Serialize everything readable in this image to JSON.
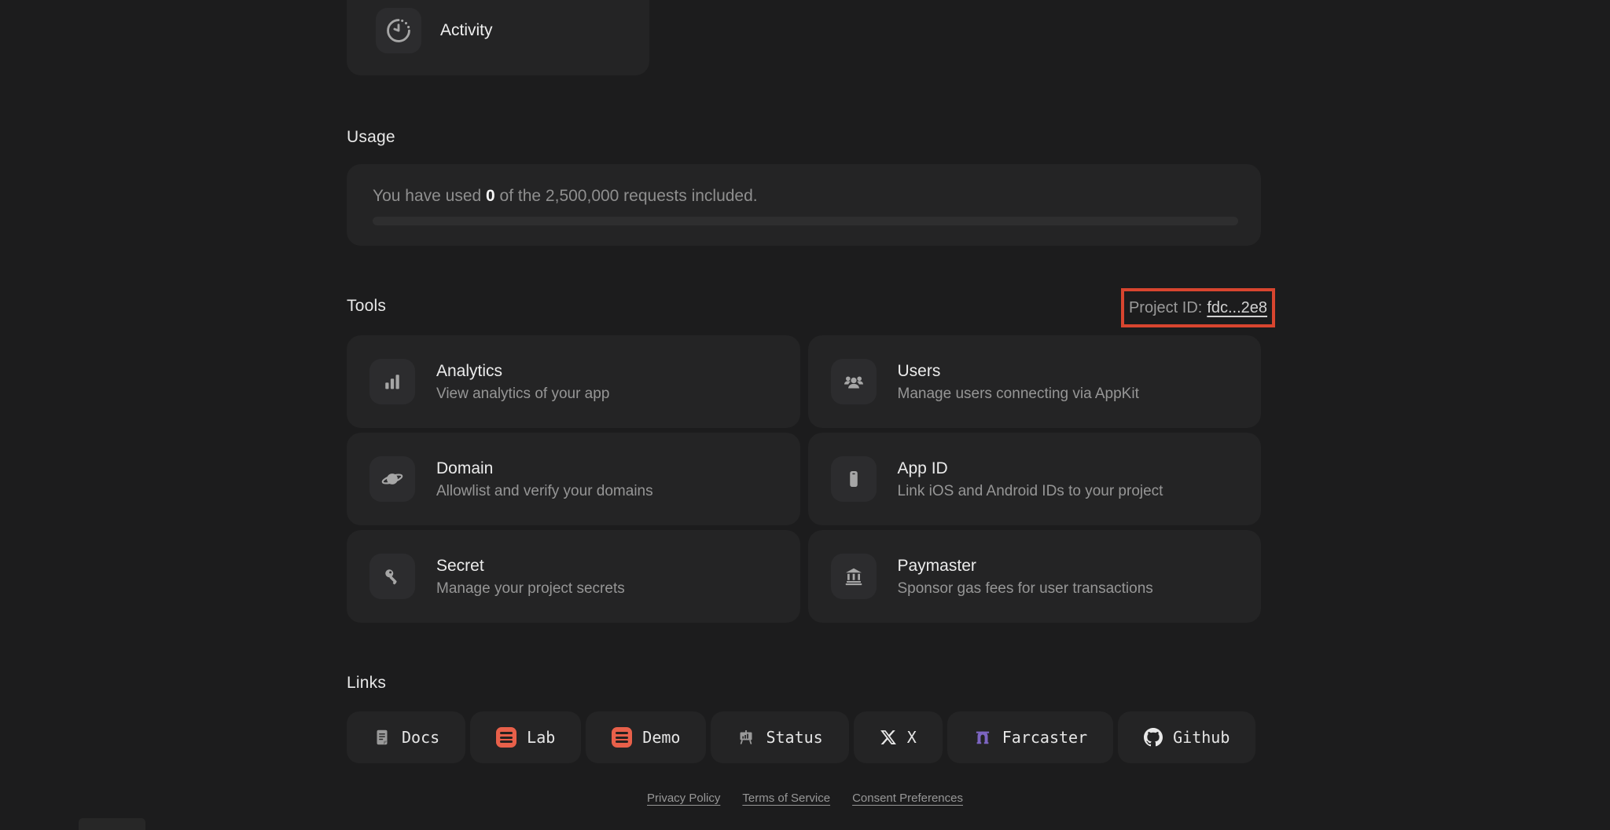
{
  "activity": {
    "label": "Activity"
  },
  "usage": {
    "heading": "Usage",
    "message_prefix": "You have used ",
    "used_count": "0",
    "message_suffix": " of the 2,500,000 requests included.",
    "progress_percent": 0
  },
  "tools": {
    "heading": "Tools",
    "project_id": {
      "label": "Project ID:",
      "value": "fdc...2e8",
      "highlight_color": "#d8452f"
    },
    "cards": [
      {
        "title": "Analytics",
        "description": "View analytics of your app",
        "icon": "bar-chart-icon"
      },
      {
        "title": "Users",
        "description": "Manage users connecting via AppKit",
        "icon": "users-icon"
      },
      {
        "title": "Domain",
        "description": "Allowlist and verify your domains",
        "icon": "planet-icon"
      },
      {
        "title": "App ID",
        "description": "Link iOS and Android IDs to your project",
        "icon": "smartphone-icon"
      },
      {
        "title": "Secret",
        "description": "Manage your project secrets",
        "icon": "key-icon"
      },
      {
        "title": "Paymaster",
        "description": "Sponsor gas fees for user transactions",
        "icon": "bank-icon"
      }
    ]
  },
  "links": {
    "heading": "Links",
    "buttons": [
      {
        "label": "Docs",
        "icon": "docs-icon"
      },
      {
        "label": "Lab",
        "icon": "lab-icon",
        "icon_color": "#e8604a"
      },
      {
        "label": "Demo",
        "icon": "demo-icon",
        "icon_color": "#e8604a"
      },
      {
        "label": "Status",
        "icon": "status-icon"
      },
      {
        "label": "X",
        "icon": "x-logo-icon"
      },
      {
        "label": "Farcaster",
        "icon": "farcaster-icon",
        "icon_color": "#7c65c1"
      },
      {
        "label": "Github",
        "icon": "github-icon"
      }
    ]
  },
  "footer": {
    "links": [
      "Privacy Policy",
      "Terms of Service",
      "Consent Preferences"
    ]
  }
}
